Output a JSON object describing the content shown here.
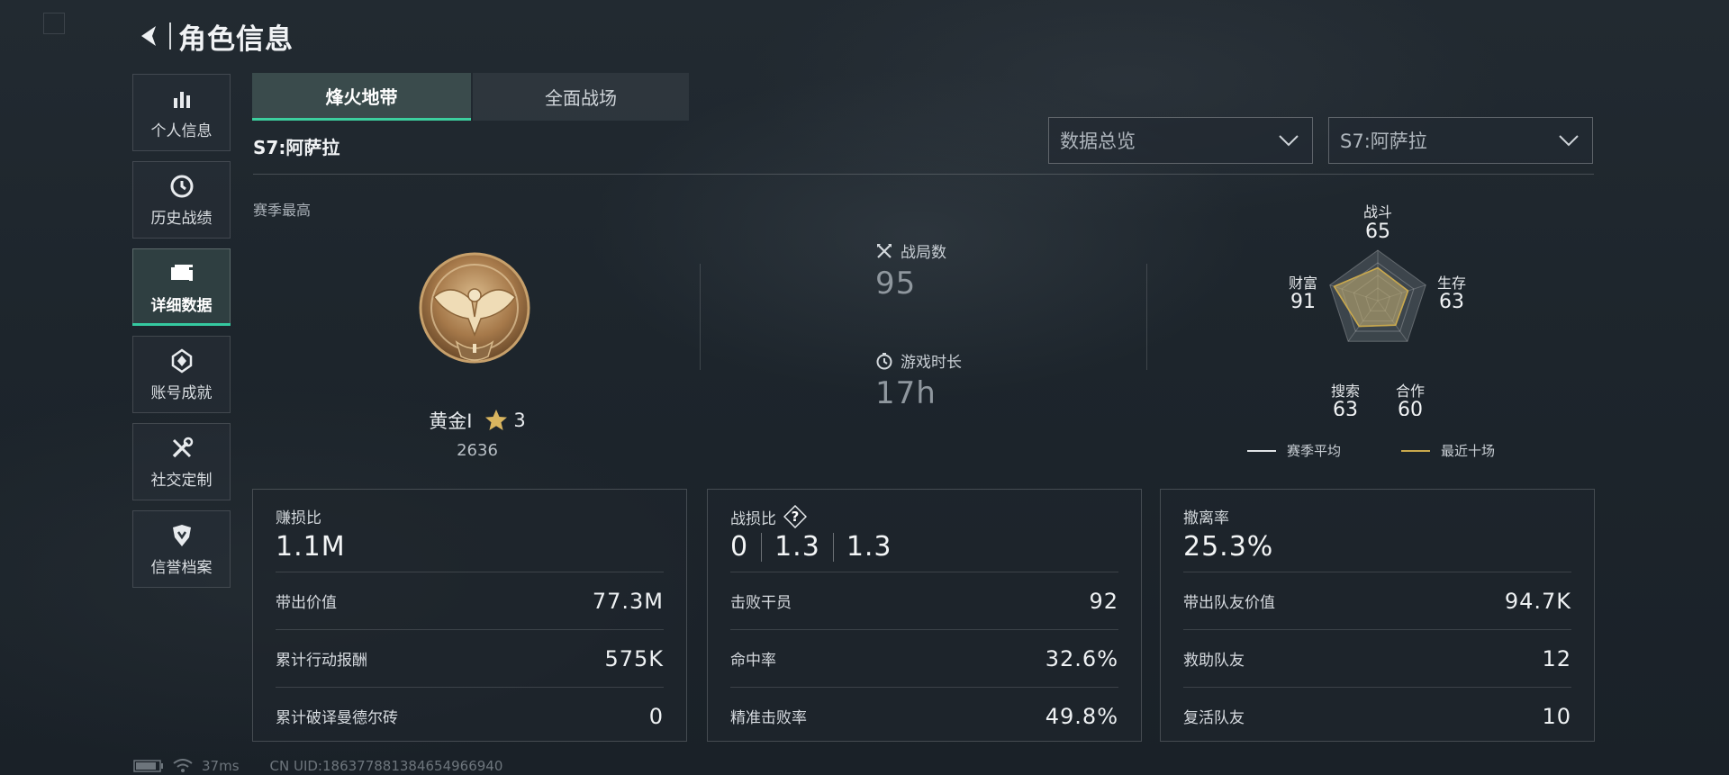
{
  "header": {
    "title": "角色信息",
    "back_icon": "back-arrow-icon"
  },
  "sidebar": {
    "items": [
      {
        "label": "个人信息",
        "icon": "bar-chart-icon",
        "active": false
      },
      {
        "label": "历史战绩",
        "icon": "clock-icon",
        "active": false
      },
      {
        "label": "详细数据",
        "icon": "cards-icon",
        "active": true
      },
      {
        "label": "账号成就",
        "icon": "badge-icon",
        "active": false
      },
      {
        "label": "社交定制",
        "icon": "tools-icon",
        "active": false
      },
      {
        "label": "信誉档案",
        "icon": "shield-icon",
        "active": false
      }
    ]
  },
  "tabs": [
    {
      "label": "烽火地带",
      "active": true
    },
    {
      "label": "全面战场",
      "active": false
    }
  ],
  "season": {
    "label": "S7:阿萨拉",
    "best_label": "赛季最高"
  },
  "filters": {
    "view": {
      "value": "数据总览"
    },
    "season": {
      "value": "S7:阿萨拉"
    }
  },
  "rank": {
    "name": "黄金I",
    "stars": "3",
    "score": "2636"
  },
  "stats": {
    "matches": {
      "label": "战局数",
      "value": "95"
    },
    "playtime": {
      "label": "游戏时长",
      "value": "17h"
    }
  },
  "chart_data": {
    "type": "radar",
    "axes": [
      {
        "label": "战斗",
        "value": 65
      },
      {
        "label": "生存",
        "value": 63
      },
      {
        "label": "合作",
        "value": 60
      },
      {
        "label": "搜索",
        "value": 63
      },
      {
        "label": "财富",
        "value": 91
      }
    ],
    "range": [
      0,
      100
    ],
    "series": [
      {
        "name": "赛季平均",
        "values": [
          65,
          63,
          60,
          63,
          91
        ],
        "color": "#e0e3e6"
      },
      {
        "name": "最近十场",
        "values": [
          65,
          63,
          60,
          63,
          91
        ],
        "color": "#c9a84c"
      }
    ],
    "legend_position": "bottom"
  },
  "cards": [
    {
      "title": "赚损比",
      "main": [
        "1.1M"
      ],
      "rows": [
        {
          "label": "带出价值",
          "value": "77.3M"
        },
        {
          "label": "累计行动报酬",
          "value": "575K"
        },
        {
          "label": "累计破译曼德尔砖",
          "value": "0"
        }
      ]
    },
    {
      "title": "战损比",
      "help": "?",
      "main": [
        "0",
        "1.3",
        "1.3"
      ],
      "rows": [
        {
          "label": "击败干员",
          "value": "92"
        },
        {
          "label": "命中率",
          "value": "32.6%"
        },
        {
          "label": "精准击败率",
          "value": "49.8%"
        }
      ]
    },
    {
      "title": "撤离率",
      "main": [
        "25.3%"
      ],
      "rows": [
        {
          "label": "带出队友价值",
          "value": "94.7K"
        },
        {
          "label": "救助队友",
          "value": "12"
        },
        {
          "label": "复活队友",
          "value": "10"
        }
      ]
    }
  ],
  "footer": {
    "latency": "37ms",
    "uid": "CN UID:18637788138465496694​0"
  },
  "colors": {
    "accent": "#3ccf9e",
    "gold": "#c9a84c",
    "background": "#1b2229"
  }
}
